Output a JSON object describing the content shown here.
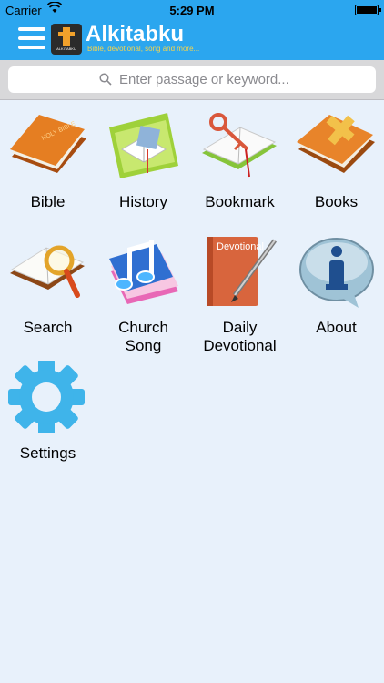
{
  "status_bar": {
    "carrier": "Carrier",
    "time": "5:29 PM"
  },
  "header": {
    "title": "Alkitabku",
    "subtitle": "Bible, devotional, song and more...",
    "logo_text": "ALKITABKU"
  },
  "search": {
    "placeholder": "Enter passage or keyword..."
  },
  "menu": [
    {
      "label": "Bible",
      "icon": "bible-book-icon"
    },
    {
      "label": "History",
      "icon": "history-bookmark-icon"
    },
    {
      "label": "Bookmark",
      "icon": "bookmark-key-icon"
    },
    {
      "label": "Books",
      "icon": "books-cross-icon"
    },
    {
      "label": "Search",
      "icon": "search-magnifier-icon"
    },
    {
      "label_line1": "Church",
      "label_line2": "Song",
      "icon": "church-song-icon"
    },
    {
      "label_line1": "Daily",
      "label_line2": "Devotional",
      "icon": "daily-devotional-icon",
      "book_text": "Devotional"
    },
    {
      "label": "About",
      "icon": "about-info-icon"
    },
    {
      "label": "Settings",
      "icon": "settings-gear-icon"
    }
  ],
  "colors": {
    "header": "#2ba6ef",
    "background": "#e8f1fb",
    "accent_orange": "#e3882a"
  }
}
